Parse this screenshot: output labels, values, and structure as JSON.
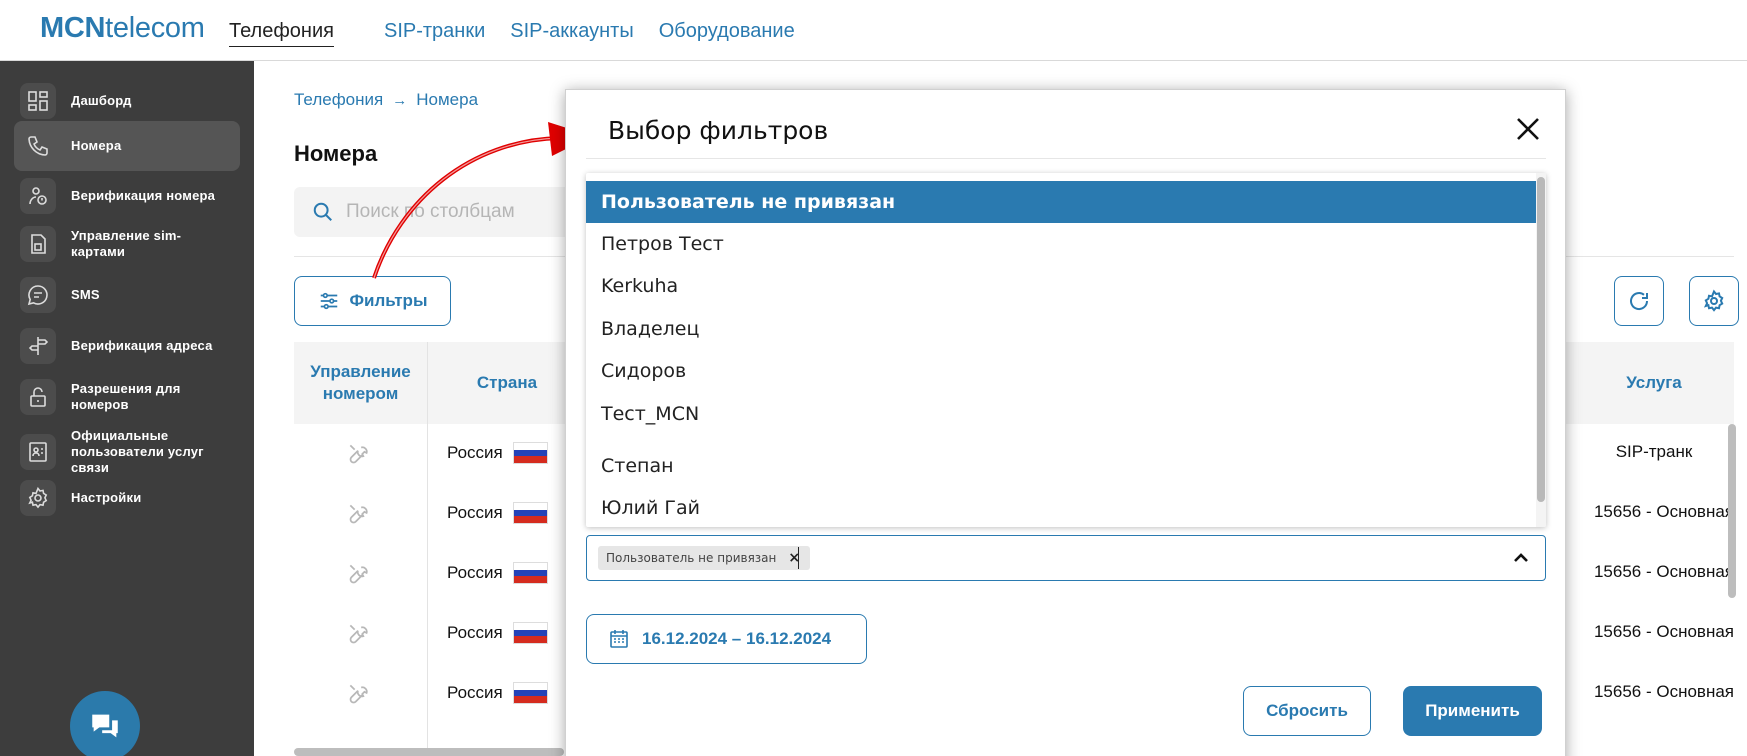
{
  "logo": {
    "bold": "MCN",
    "regular": "telecom"
  },
  "topnav": [
    {
      "label": "Телефония",
      "active": true
    },
    {
      "label": "SIP-транки",
      "active": false
    },
    {
      "label": "SIP-аккаунты",
      "active": false
    },
    {
      "label": "Оборудование",
      "active": false
    }
  ],
  "sidebar": {
    "items": [
      {
        "label": "Дашборд",
        "icon": "dashboard-icon"
      },
      {
        "label": "Номера",
        "icon": "phone-icon",
        "active": true
      },
      {
        "label": "Верификация номера",
        "icon": "verify-number-icon"
      },
      {
        "label": "Управление sim-картами",
        "icon": "sim-card-icon"
      },
      {
        "label": "SMS",
        "icon": "sms-icon"
      },
      {
        "label": "Верификация адреса",
        "icon": "signpost-icon"
      },
      {
        "label": "Разрешения для номеров",
        "icon": "lock-icon"
      },
      {
        "label": "Официальные пользователи услуг связи",
        "icon": "id-card-icon"
      },
      {
        "label": "Настройки",
        "icon": "gear-icon"
      }
    ]
  },
  "breadcrumb": {
    "parent": "Телефония",
    "current": "Номера"
  },
  "page": {
    "title": "Номера"
  },
  "search": {
    "placeholder": "Поиск по столбцам"
  },
  "toolbar": {
    "filters_label": "Фильтры"
  },
  "table": {
    "headers": {
      "management": "Управление номером",
      "country": "Страна",
      "service": "Услуга"
    },
    "rows": [
      {
        "country": "Россия",
        "service": "SIP-транк"
      },
      {
        "country": "Россия",
        "service": "15656 - Основная"
      },
      {
        "country": "Россия",
        "service": "15656 - Основная"
      },
      {
        "country": "Россия",
        "service": "15656 - Основная"
      },
      {
        "country": "Россия",
        "service": "15656 - Основная"
      }
    ]
  },
  "modal": {
    "title": "Выбор фильтров",
    "options": [
      "Пользователь не привязан",
      "Петров Тест",
      "Kerkuha",
      "Владелец",
      "Сидоров",
      "Тест_MCN",
      "Степан",
      "Юлий Гай"
    ],
    "selected_chip": "Пользователь не привязан",
    "date_range": "16.12.2024 – 16.12.2024",
    "reset_label": "Сбросить",
    "apply_label": "Применить"
  },
  "colors": {
    "accent": "#2a7ab0",
    "sidebar": "#3d3d3d",
    "annotation_arrow": "#e00000"
  }
}
